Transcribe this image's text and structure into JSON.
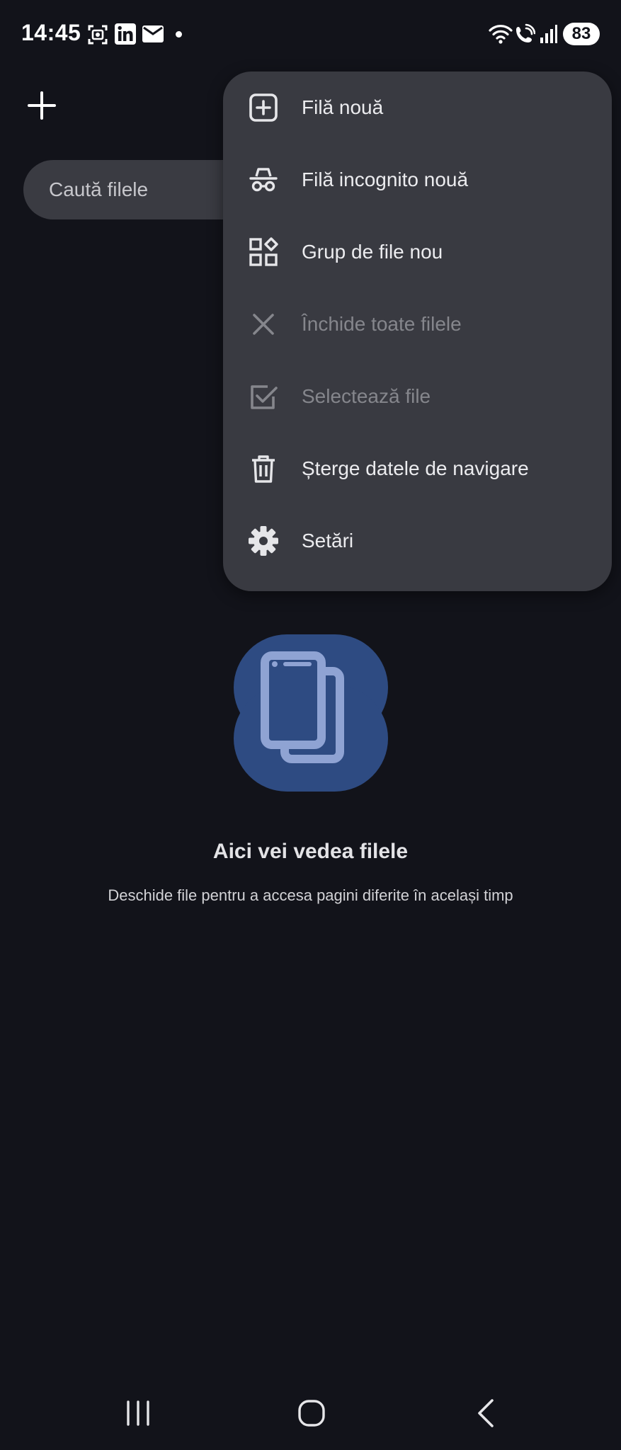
{
  "status_bar": {
    "time": "14:45",
    "battery": "83",
    "icons": [
      "screenshot-icon",
      "linkedin-icon",
      "mail-icon",
      "notification-dot-icon",
      "wifi-icon",
      "wifi-calling-icon",
      "signal-icon"
    ]
  },
  "toolbar": {
    "add_icon": "plus-icon",
    "search_placeholder": "Caută filele"
  },
  "menu": {
    "items": [
      {
        "label": "Filă nouă",
        "icon": "new-tab-icon",
        "enabled": true
      },
      {
        "label": "Filă incognito nouă",
        "icon": "incognito-icon",
        "enabled": true
      },
      {
        "label": "Grup de file nou",
        "icon": "tab-group-icon",
        "enabled": true
      },
      {
        "label": "Închide toate filele",
        "icon": "close-icon",
        "enabled": false
      },
      {
        "label": "Selectează file",
        "icon": "checkbox-icon",
        "enabled": false
      },
      {
        "label": "Șterge datele de navigare",
        "icon": "trash-icon",
        "enabled": true
      },
      {
        "label": "Setări",
        "icon": "gear-icon",
        "enabled": true
      }
    ]
  },
  "empty_state": {
    "title": "Aici vei vedea filele",
    "subtitle": "Deschide file pentru a accesa pagini diferite în același timp",
    "illustration": "tabs-illustration-icon"
  },
  "nav_bar": {
    "items": [
      "recents-icon",
      "home-icon",
      "back-icon"
    ]
  },
  "colors": {
    "background": "#12131a",
    "surface": "#393a41",
    "accent_blue": "#2e4b82",
    "illustration_light": "#8fa3d3"
  }
}
